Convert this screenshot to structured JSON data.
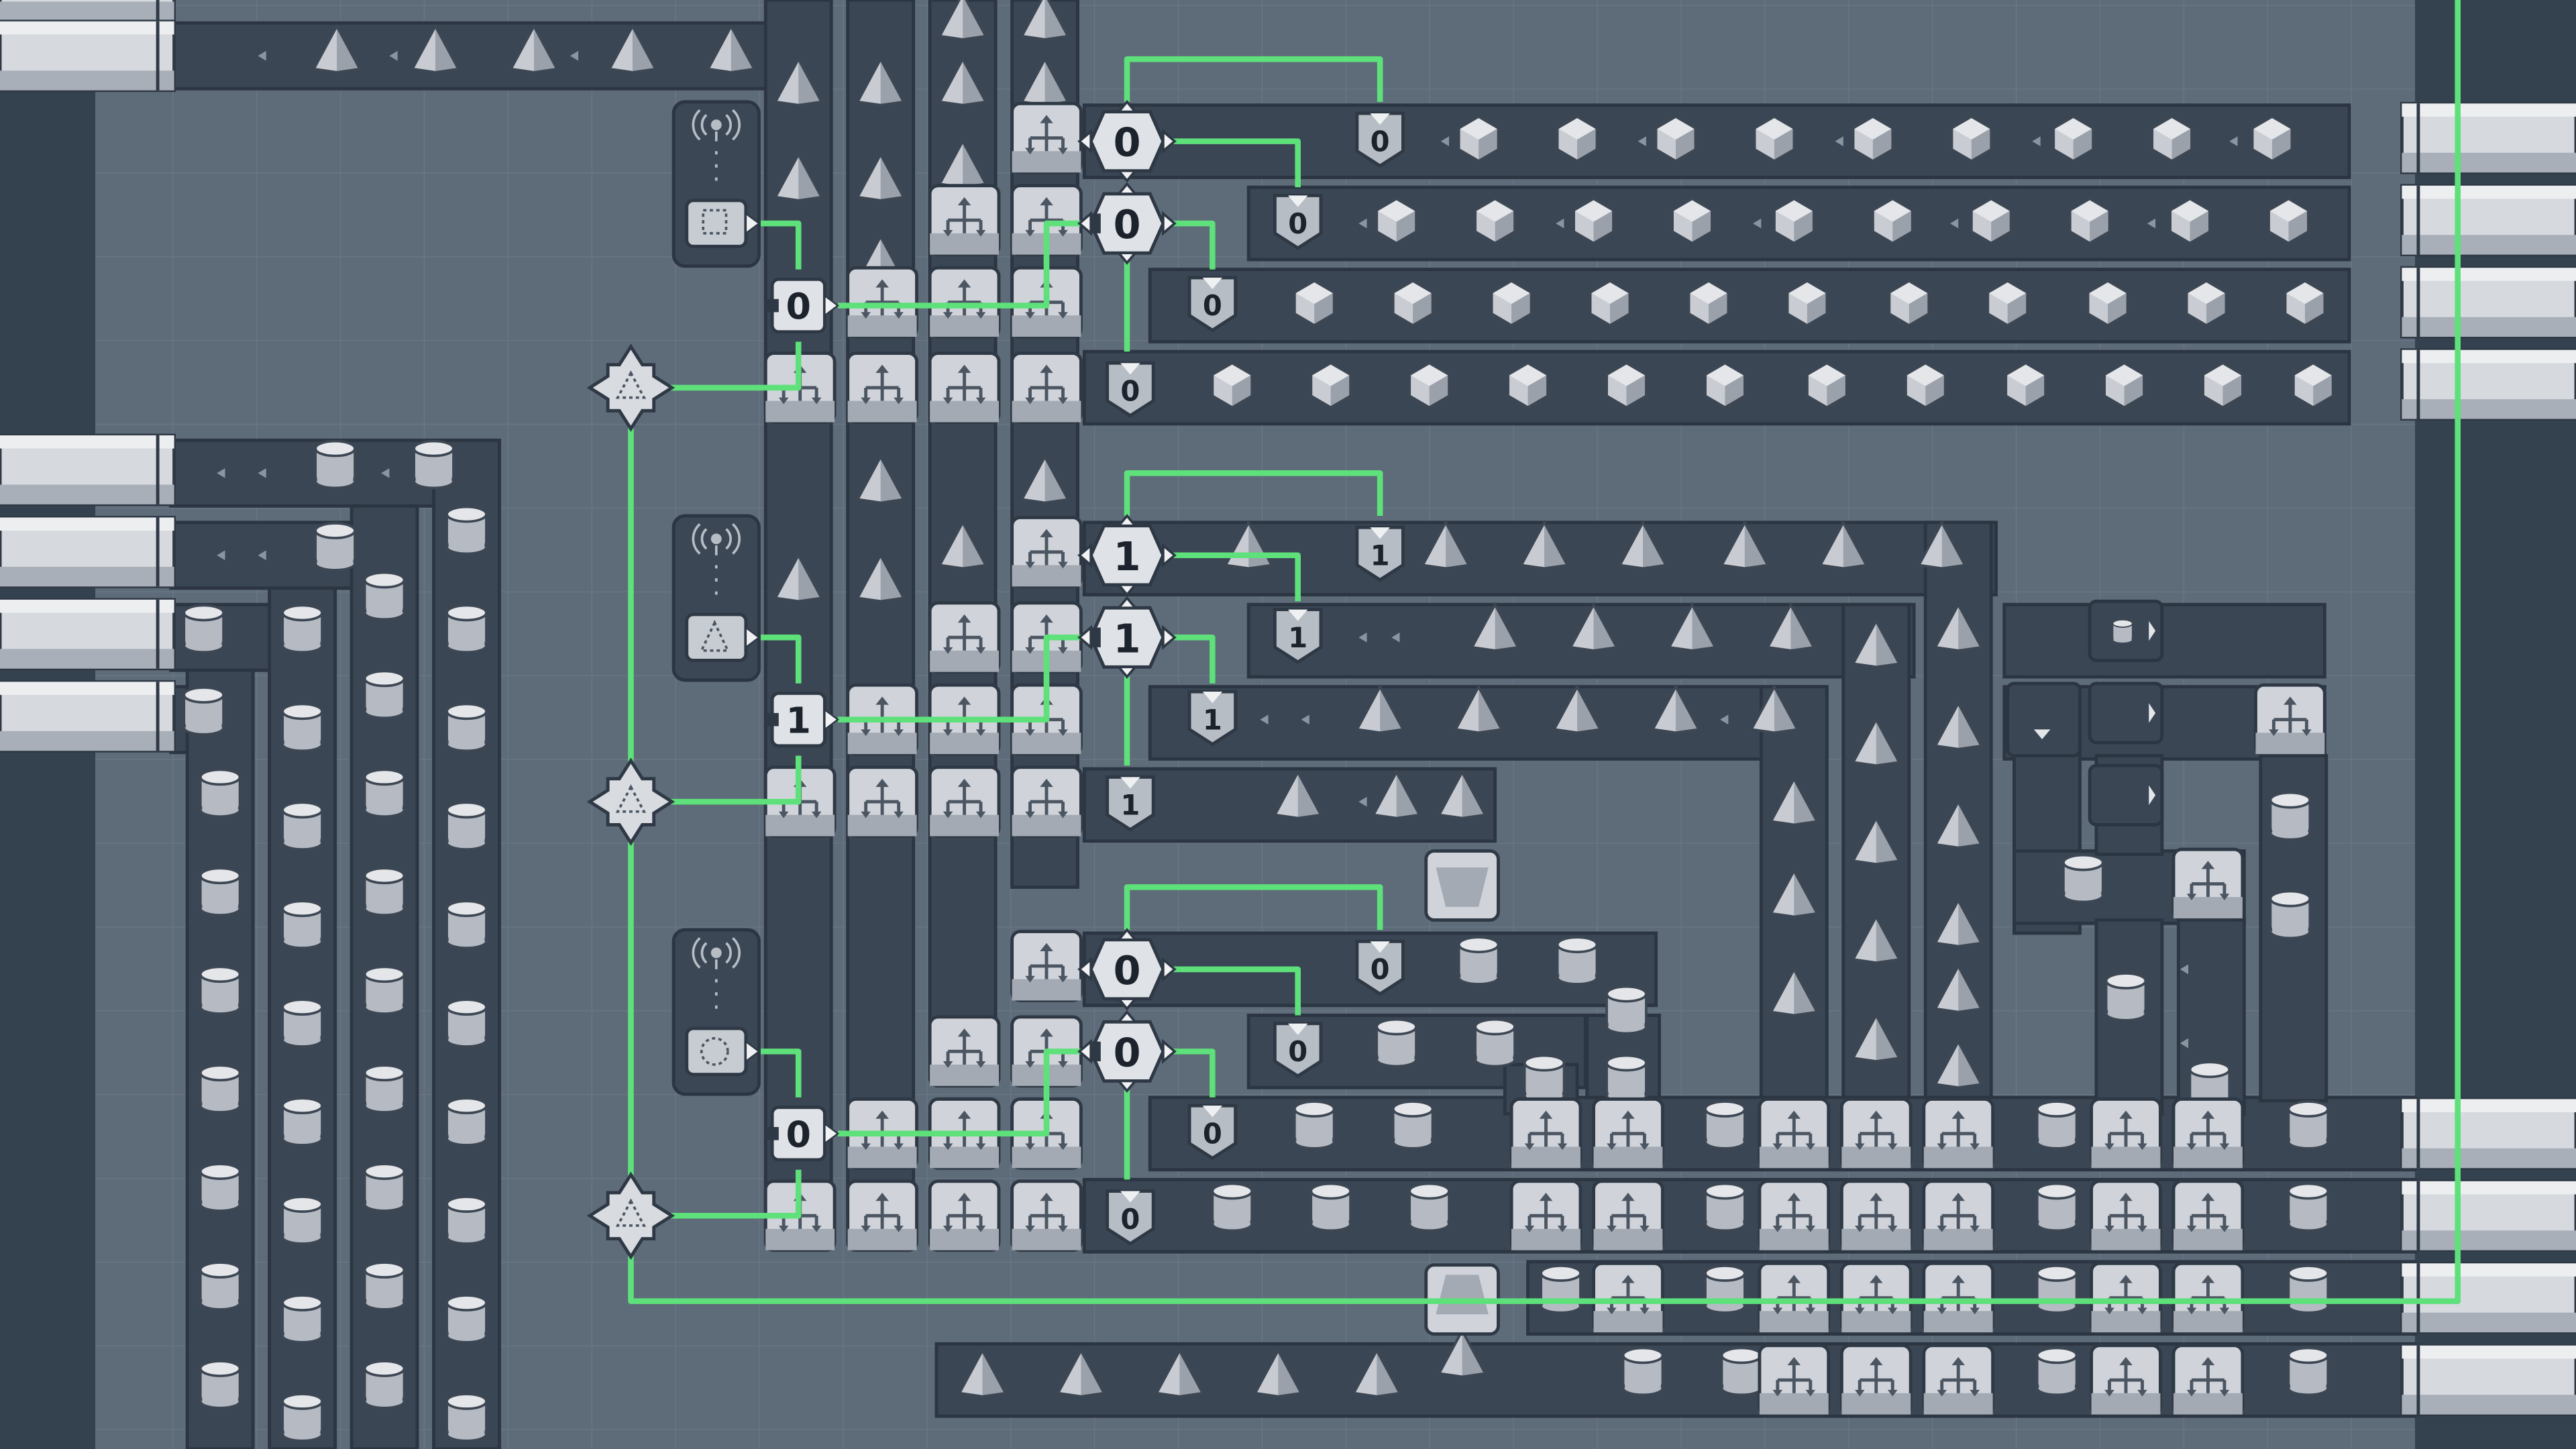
{
  "game": "Factory logic circuit view",
  "colors": {
    "background": "#5e6b79",
    "grid_line": "#6a7787",
    "dark_void": "#34414f",
    "conveyor": "#3a4654",
    "conveyor_edge": "#2c3642",
    "signal_wire": "#5ee07a",
    "building": "#d4d7dc",
    "building_shade": "#a9afb8",
    "hub_dock": "#cfd3d9"
  },
  "item_shapes": {
    "top_section": "cube-icon",
    "middle_section": "pyramid-icon",
    "bottom_section": "cylinder-icon"
  },
  "sections": [
    {
      "name": "top-block",
      "antenna_icon": "antenna-icon",
      "detector_icon": "square-outline-icon",
      "logic_gates": [
        {
          "value": "0"
        },
        {
          "value": "0"
        },
        {
          "value": "0"
        }
      ],
      "display_signals": [
        {
          "value": "0"
        },
        {
          "value": "0"
        },
        {
          "value": "0"
        },
        {
          "value": "0"
        }
      ]
    },
    {
      "name": "middle-block",
      "antenna_icon": "antenna-icon",
      "detector_icon": "triangle-outline-icon",
      "logic_gates": [
        {
          "value": "1"
        },
        {
          "value": "1"
        },
        {
          "value": "1"
        }
      ],
      "display_signals": [
        {
          "value": "1"
        },
        {
          "value": "1"
        },
        {
          "value": "1"
        },
        {
          "value": "1"
        }
      ]
    },
    {
      "name": "bottom-block",
      "antenna_icon": "antenna-icon",
      "detector_icon": "circle-outline-icon",
      "logic_gates": [
        {
          "value": "0"
        },
        {
          "value": "0"
        },
        {
          "value": "0"
        }
      ],
      "display_signals": [
        {
          "value": "0"
        },
        {
          "value": "0"
        },
        {
          "value": "0"
        },
        {
          "value": "0"
        }
      ]
    }
  ]
}
